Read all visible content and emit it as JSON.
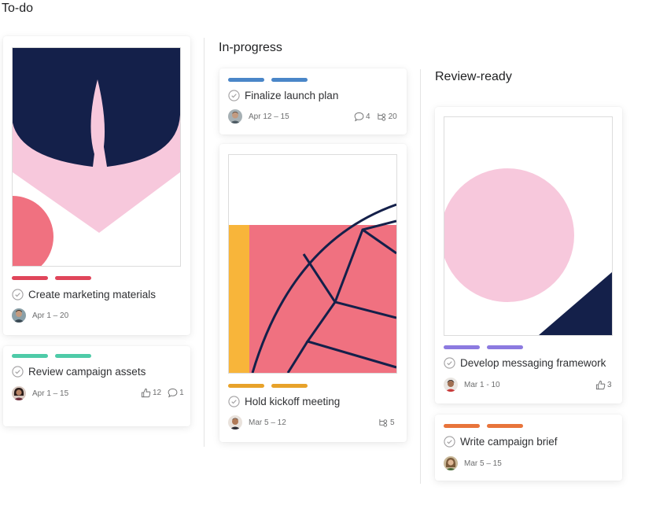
{
  "columns": [
    {
      "title": "To-do"
    },
    {
      "title": "In-progress"
    },
    {
      "title": "Review-ready"
    }
  ],
  "colors": {
    "red_tag": "#e0455a",
    "teal_tag": "#4ecba8",
    "blue_tag": "#4a86c8",
    "orange_tag": "#e8a22a",
    "purple_tag": "#8c7ae0",
    "coral_tag": "#e8743b",
    "navy": "#14204a",
    "pink": "#f7c8dc",
    "salmon": "#f07180",
    "yellow": "#f8b53a"
  },
  "cards": {
    "marketing_materials": {
      "title": "Create marketing materials",
      "dates": "Apr 1 – 20"
    },
    "campaign_assets": {
      "title": "Review campaign assets",
      "dates": "Apr 1 – 15",
      "likes": "12",
      "comments": "1"
    },
    "launch_plan": {
      "title": "Finalize launch plan",
      "dates": "Apr 12 – 15",
      "comments": "4",
      "subtasks": "20"
    },
    "kickoff_meeting": {
      "title": "Hold kickoff meeting",
      "dates": "Mar 5 – 12",
      "subtasks": "5"
    },
    "messaging_framework": {
      "title": "Develop messaging framework",
      "dates": "Mar 1 - 10",
      "likes": "3"
    },
    "campaign_brief": {
      "title": "Write campaign brief",
      "dates": "Mar 5 – 15"
    }
  }
}
